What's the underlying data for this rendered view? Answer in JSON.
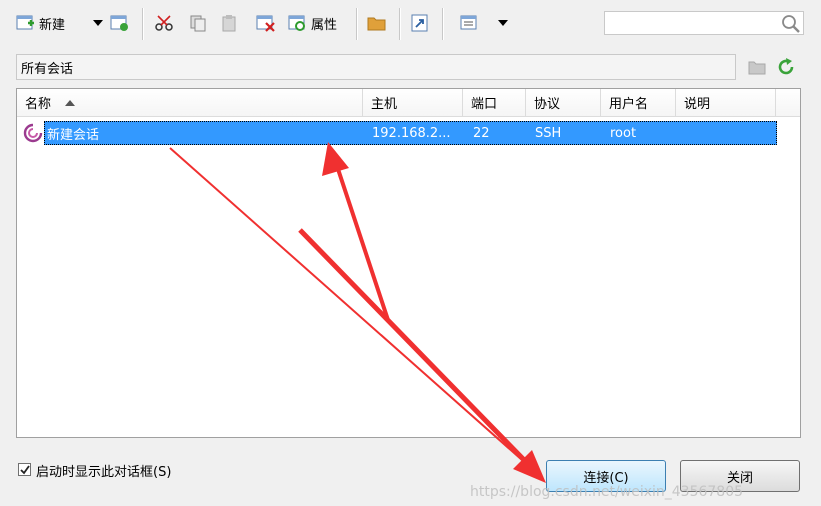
{
  "toolbar": {
    "new_label": "新建",
    "properties_label": "属性",
    "search_placeholder": ""
  },
  "path": {
    "current": "所有会话"
  },
  "list": {
    "columns": [
      "名称",
      "主机",
      "端口",
      "协议",
      "用户名",
      "说明"
    ],
    "sort_column": "名称",
    "sort_direction": "ascending",
    "rows": [
      {
        "name": "新建会话",
        "host": "192.168.2...",
        "port": "22",
        "protocol": "SSH",
        "user": "root",
        "desc": ""
      }
    ],
    "selected_row": 0
  },
  "footer": {
    "show_on_startup_label": "启动时显示此对话框(S)",
    "show_on_startup_checked": true,
    "connect_label": "连接(C)",
    "close_label": "关闭"
  },
  "watermark": "https://blog.csdn.net/weixin_43567805",
  "colors": {
    "selection": "#3399ff",
    "annotation_arrow": "#f03030",
    "refresh_icon": "#3aa33a"
  },
  "icons": {
    "new": "new-session-icon",
    "session": "xshell-session-icon",
    "refresh": "refresh-icon",
    "search": "search-icon"
  }
}
